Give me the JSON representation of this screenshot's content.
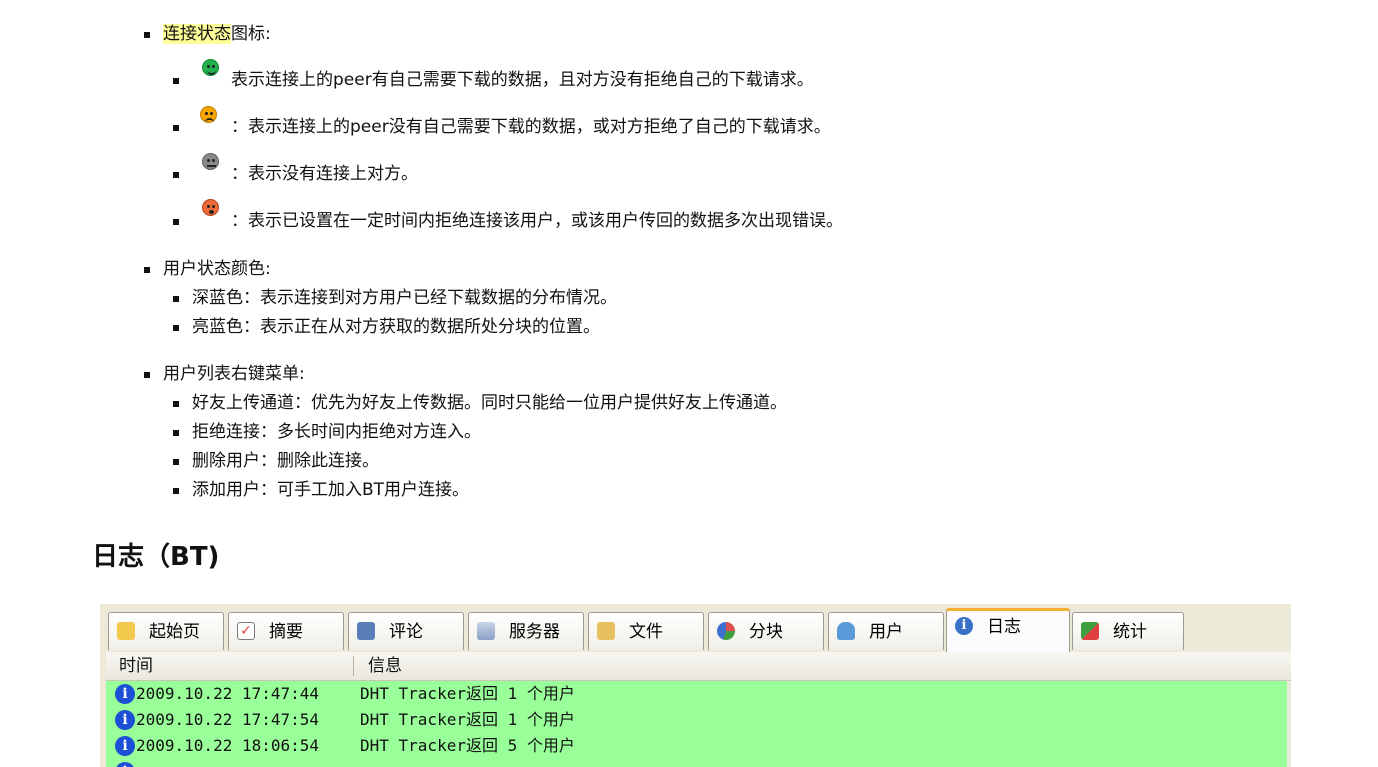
{
  "sections": {
    "connection_status": {
      "title_highlight": "连接状态",
      "title_rest": "图标:",
      "items": [
        {
          "icon": "green-face-icon",
          "color": "#22b14c",
          "text": "表示连接上的peer有自己需要下载的数据，且对方没有拒绝自己的下载请求。"
        },
        {
          "icon": "orange-face-icon",
          "color": "#f7a600",
          "text": "：表示连接上的peer没有自己需要下载的数据，或对方拒绝了自己的下载请求。"
        },
        {
          "icon": "gray-face-icon",
          "color": "#8a8a8a",
          "text": "：表示没有连接上对方。"
        },
        {
          "icon": "red-face-icon",
          "color": "#f06a3a",
          "text": "：表示已设置在一定时间内拒绝连接该用户，或该用户传回的数据多次出现错误。"
        }
      ]
    },
    "user_status_color": {
      "title": "用户状态颜色:",
      "items": [
        "深蓝色：表示连接到对方用户已经下载数据的分布情况。",
        "亮蓝色：表示正在从对方获取的数据所处分块的位置。"
      ]
    },
    "user_list_menu": {
      "title": "用户列表右键菜单:",
      "items": [
        "好友上传通道：优先为好友上传数据。同时只能给一位用户提供好友上传通道。",
        "拒绝连接：多长时间内拒绝对方连入。",
        "删除用户：删除此连接。",
        "添加用户：可手工加入BT用户连接。"
      ]
    }
  },
  "heading": "日志（BT)",
  "screenshot": {
    "tabs": [
      {
        "label": "起始页",
        "icon": "home-page-icon",
        "color": "#f2c94c"
      },
      {
        "label": "摘要",
        "icon": "checklist-icon",
        "color": "#e04040"
      },
      {
        "label": "评论",
        "icon": "comment-icon",
        "color": "#5a7fb8"
      },
      {
        "label": "服务器",
        "icon": "server-icon",
        "color": "#8aa0c8"
      },
      {
        "label": "文件",
        "icon": "file-icon",
        "color": "#e8c060"
      },
      {
        "label": "分块",
        "icon": "pie-icon",
        "color": "#e05050"
      },
      {
        "label": "用户",
        "icon": "user-icon",
        "color": "#5a9ad8"
      },
      {
        "label": "日志",
        "icon": "log-info-icon",
        "color": "#3a70c8"
      },
      {
        "label": "统计",
        "icon": "stats-icon",
        "color": "#40a040"
      }
    ],
    "columns": {
      "time": "时间",
      "info": "信息"
    },
    "rows": [
      {
        "time": "2009.10.22 17:47:44",
        "msg": "DHT Tracker返回 1 个用户"
      },
      {
        "time": "2009.10.22 17:47:54",
        "msg": "DHT Tracker返回 1 个用户"
      },
      {
        "time": "2009.10.22 18:06:54",
        "msg": "DHT Tracker返回 5 个用户"
      }
    ]
  }
}
